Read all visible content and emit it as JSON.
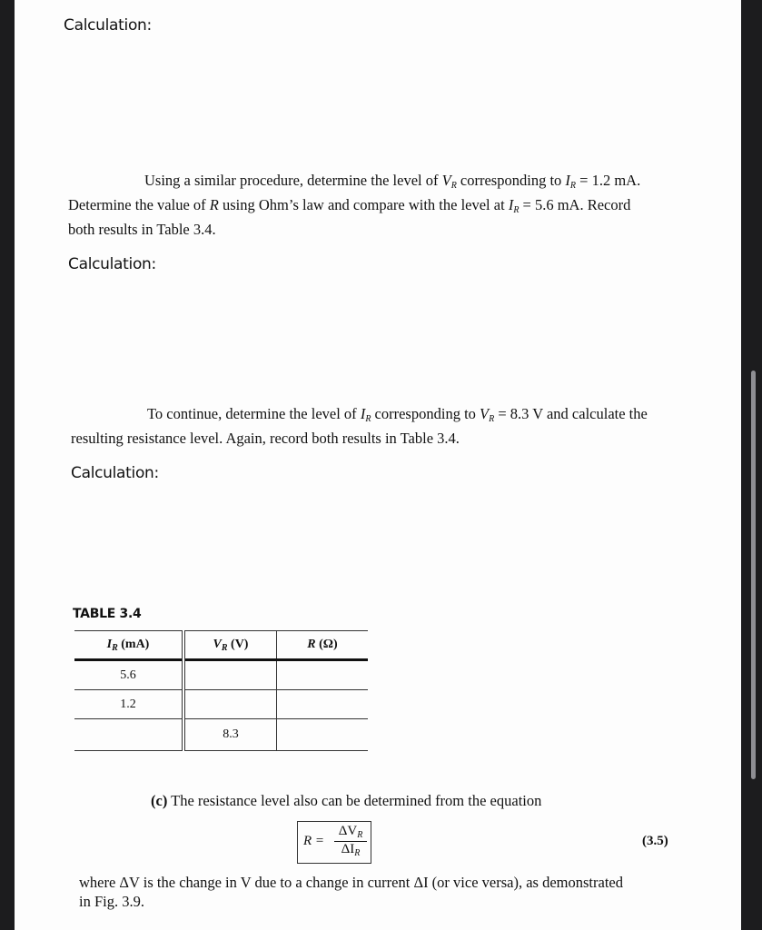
{
  "headings": [
    "Calculation:",
    "Calculation:",
    "Calculation:"
  ],
  "para1": {
    "t1": "Using a similar procedure, determine the level of ",
    "v": "V",
    "vsub": "R",
    "t2": " corresponding to ",
    "i": "I",
    "isub": "R",
    "t3": " = 1.2 mA.",
    "t4": "Determine the value of ",
    "r": "R",
    "t5": " using Ohm’s law and compare with the level at ",
    "t6": " = 5.6 mA. Record",
    "t7": "both results in Table 3.4."
  },
  "para2": {
    "t1": "To continue, determine the level of ",
    "t2": " corresponding to ",
    "t3": " = 8.3 V and calculate the",
    "t4": "resulting resistance level. Again, record both results in Table 3.4."
  },
  "table": {
    "title": "TABLE 3.4",
    "headers": [
      {
        "sym": "I",
        "sub": "R",
        "unit": " (mA)"
      },
      {
        "sym": "V",
        "sub": "R",
        "unit": " (V)"
      },
      {
        "sym": "R",
        "sub": "",
        "unit": " (Ω)"
      }
    ],
    "rows": [
      [
        "5.6",
        "",
        ""
      ],
      [
        "1.2",
        "",
        ""
      ],
      [
        "",
        "8.3",
        ""
      ]
    ]
  },
  "para3": {
    "label": "(c)",
    "text": " The resistance level also can be determined from the equation"
  },
  "equation": {
    "lhs": "R =",
    "num": "ΔV",
    "num_sub": "R",
    "den": "ΔI",
    "den_sub": "R",
    "number": "(3.5)"
  },
  "para4": {
    "t1": "where ΔV is the change in V due to a change in current ΔI (or vice versa), as demonstrated",
    "t2": "in Fig. 3.9."
  }
}
